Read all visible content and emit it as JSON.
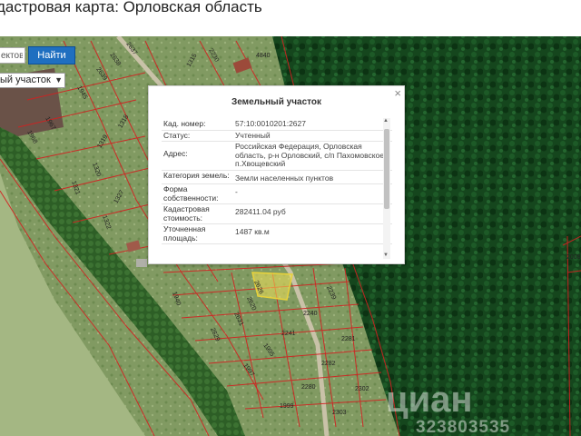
{
  "page": {
    "title": "дастровая карта: Орловская область"
  },
  "search": {
    "input_value": "ектов",
    "find_label": "Найти",
    "type_select_value": "ый участок"
  },
  "popup": {
    "title": "Земельный участок",
    "close_label": "×",
    "rows": [
      {
        "key": "Кад. номер:",
        "value": "57:10:0010201:2627"
      },
      {
        "key": "Статус:",
        "value": "Учтенный"
      },
      {
        "key": "Адрес:",
        "value": "Российская Федерация, Орловская область, р-н Орловский, с/п Пахомовское, п.Хвощевский"
      },
      {
        "key": "Категория земель:",
        "value": "Земли населенных пунктов"
      },
      {
        "key": "Форма собственности:",
        "value": "-"
      },
      {
        "key": "Кадастровая стоимость:",
        "value": "282411.04 руб"
      },
      {
        "key": "Уточненная площадь:",
        "value": "1487 кв.м"
      }
    ]
  },
  "parcels": [
    "2637",
    "2638",
    "2639",
    "1315",
    "4840",
    "2230",
    "2639",
    "1945",
    "1967",
    "1968",
    "1319",
    "1318",
    "1320",
    "1321",
    "1327",
    "1322",
    "1940",
    "2626",
    "2239",
    "2240",
    "2620",
    "2241",
    "2631",
    "2829",
    "1995",
    "2281",
    "1997",
    "2282",
    "2280",
    "2302",
    "1999",
    "2303",
    "2008"
  ],
  "watermark": {
    "brand": "циан",
    "id": "323803535"
  },
  "colors": {
    "forest": "#0f3d18",
    "field": "#7f9a5a",
    "boundary": "#d42020",
    "selected_parcel": "#f2e25a",
    "find_button": "#1f6fc0"
  }
}
